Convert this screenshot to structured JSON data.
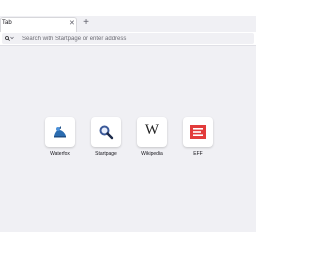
{
  "tabs": [
    {
      "title": "Tab",
      "close_glyph": "✕"
    }
  ],
  "new_tab_glyph": "+",
  "urlbar": {
    "search_engine_icon": "search-icon",
    "placeholder": "Search with Startpage or enter address",
    "value": ""
  },
  "top_sites": [
    {
      "label": "Waterfox",
      "icon": "waterfox-logo-icon",
      "color": "#2b6cb0"
    },
    {
      "label": "Startpage",
      "icon": "magnifier-icon",
      "color": "#3b5998"
    },
    {
      "label": "Wikipedia",
      "icon": "wikipedia-w-icon",
      "glyph": "W",
      "color": "#222222"
    },
    {
      "label": "EFF",
      "icon": "eff-logo-icon",
      "color": "#e23b3b"
    }
  ]
}
